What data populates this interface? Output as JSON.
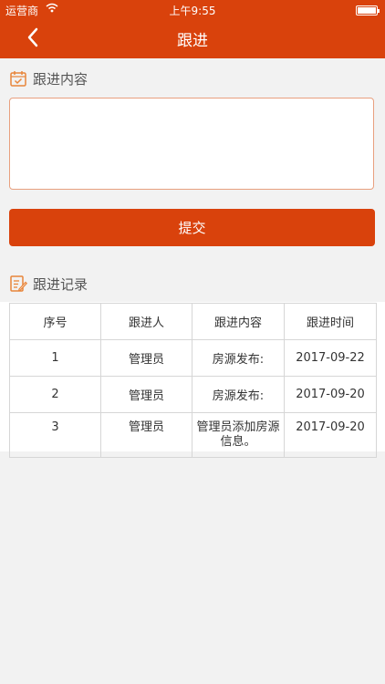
{
  "status_bar": {
    "carrier": "运营商",
    "time": "上午9:55"
  },
  "nav": {
    "title": "跟进",
    "back_icon": "chevron-left-icon"
  },
  "followup_content": {
    "label": "跟进内容",
    "icon": "calendar-check-icon",
    "value": ""
  },
  "submit_label": "提交",
  "records": {
    "label": "跟进记录",
    "icon": "note-edit-icon",
    "headers": [
      "序号",
      "跟进人",
      "跟进内容",
      "跟进时间"
    ],
    "rows": [
      [
        "1",
        "管理员",
        "房源发布:",
        "2017-09-22"
      ],
      [
        "2",
        "管理员",
        "房源发布:",
        "2017-09-20"
      ],
      [
        "3",
        "管理员",
        "管理员添加房源信息。",
        "2017-09-20"
      ]
    ]
  },
  "colors": {
    "accent": "#d9420c",
    "icon": "#e8853a"
  }
}
